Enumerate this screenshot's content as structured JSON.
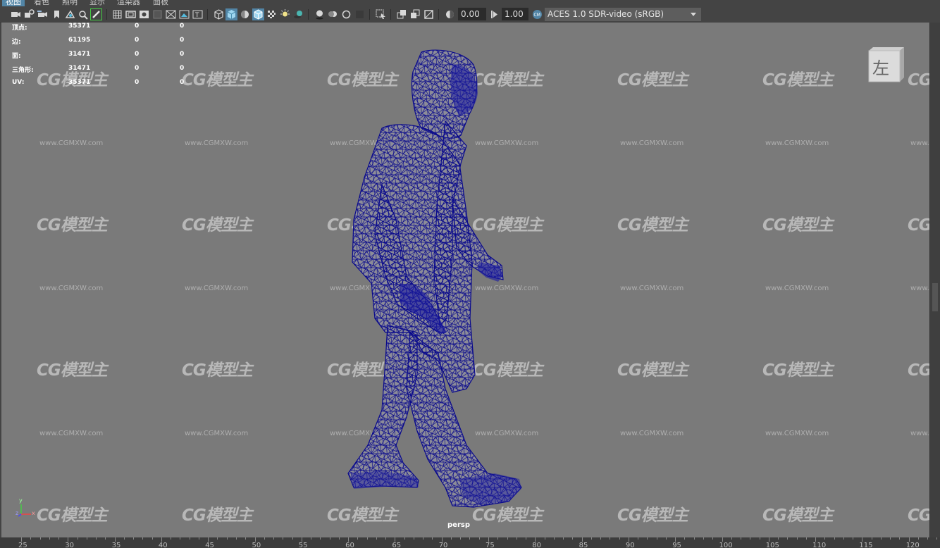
{
  "menu": {
    "items": [
      "视图",
      "着色",
      "照明",
      "显示",
      "渲染器",
      "面板"
    ]
  },
  "toolbar": {
    "exposure_value": "0.00",
    "gamma_value": "1.00",
    "color_space": "ACES 1.0 SDR-video (sRGB)"
  },
  "hud": {
    "rows": [
      {
        "label": "顶点:",
        "total": "35371",
        "selected": "0",
        "components": "0"
      },
      {
        "label": "边:",
        "total": "61195",
        "selected": "0",
        "components": "0"
      },
      {
        "label": "面:",
        "total": "31471",
        "selected": "0",
        "components": "0"
      },
      {
        "label": "三角形:",
        "total": "31471",
        "selected": "0",
        "components": "0"
      },
      {
        "label": "UV:",
        "total": "35371",
        "selected": "0",
        "components": "0"
      }
    ]
  },
  "viewport": {
    "camera": "persp",
    "viewcube_face": "左",
    "watermark_logo": "CG模型主",
    "watermark_url": "www.CGMXW.com",
    "axis_labels": [
      "y",
      "z",
      "x"
    ]
  },
  "timeline": {
    "ticks": [
      "25",
      "30",
      "35",
      "40",
      "45",
      "50",
      "55",
      "60",
      "65",
      "70",
      "75",
      "80",
      "85",
      "90",
      "95",
      "100",
      "105",
      "110",
      "115",
      "120"
    ]
  },
  "colors": {
    "viewport_bg": "#7a7a7a",
    "wireframe": "#0a0a8c",
    "mesh_fill": "#8c8c98",
    "accent": "#5285a6",
    "ui_dark": "#444444"
  }
}
